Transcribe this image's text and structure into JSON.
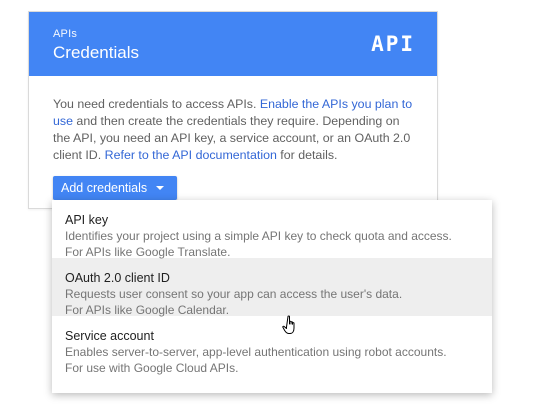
{
  "card": {
    "eyebrow": "APIs",
    "title": "Credentials",
    "logo_text": "API",
    "body_text_1": "You need credentials to access APIs. ",
    "link_enable": "Enable the APIs you plan to use",
    "body_text_2": " and then create the credentials they require. Depending on the API, you need an API key, a service account, or an OAuth 2.0 client ID. ",
    "link_docs": "Refer to the API documentation",
    "body_text_3": " for details."
  },
  "button": {
    "label": "Add credentials"
  },
  "menu": {
    "items": [
      {
        "title": "API key",
        "desc1": "Identifies your project using a simple API key to check quota and access.",
        "desc2": "For APIs like Google Translate."
      },
      {
        "title": "OAuth 2.0 client ID",
        "desc1": "Requests user consent so your app can access the user's data.",
        "desc2": "For APIs like Google Calendar."
      },
      {
        "title": "Service account",
        "desc1": "Enables server-to-server, app-level authentication using robot accounts.",
        "desc2": "For use with Google Cloud APIs."
      }
    ]
  },
  "colors": {
    "header_blue": "#4285f4",
    "link_blue": "#3367d6",
    "hover_gray": "#eeeeee"
  },
  "icons": {
    "cursor": "hand-pointer-icon",
    "caret": "caret-down-icon"
  }
}
